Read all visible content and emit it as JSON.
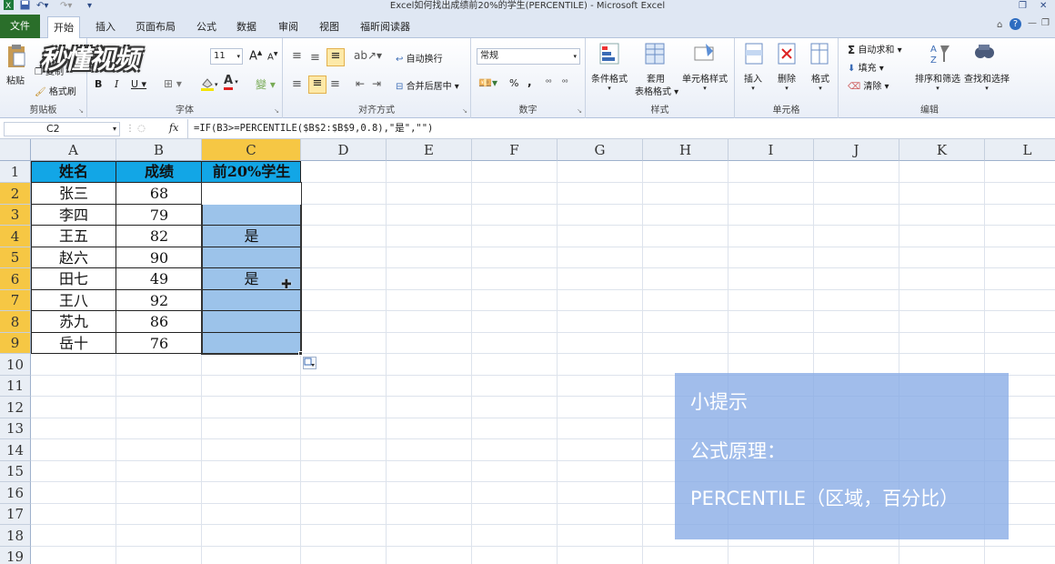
{
  "window": {
    "title": "Excel如何找出成绩前20%的学生(PERCENTILE)  -  Microsoft Excel"
  },
  "ribbon_tabs": [
    "文件",
    "开始",
    "插入",
    "页面布局",
    "公式",
    "数据",
    "审阅",
    "视图",
    "福昕阅读器"
  ],
  "ribbon": {
    "clipboard": {
      "paste": "粘贴",
      "copy": "复制",
      "format_painter": "格式刷",
      "label": "剪贴板"
    },
    "font": {
      "size": "11",
      "label": "字体",
      "bold": "B",
      "italic": "I",
      "underline": "U"
    },
    "alignment": {
      "wrap": "自动换行",
      "merge": "合并后居中",
      "label": "对齐方式"
    },
    "number": {
      "format": "常规",
      "percent": "%",
      "comma": ",",
      "label": "数字"
    },
    "styles": {
      "conditional": "条件格式",
      "table_fmt_1": "套用",
      "table_fmt_2": "表格格式",
      "cell_styles": "单元格样式",
      "label": "样式"
    },
    "cells": {
      "insert": "插入",
      "delete": "删除",
      "format": "格式",
      "label": "单元格"
    },
    "editing": {
      "autosum": "自动求和",
      "fill": "填充",
      "clear": "清除",
      "sort": "排序和筛选",
      "find": "查找和选择",
      "label": "编辑"
    }
  },
  "watermark_logo": "秒懂视频",
  "formula_bar": {
    "name_box": "C2",
    "fx": "fx",
    "formula": "=IF(B3>=PERCENTILE($B$2:$B$9,0.8),\"是\",\"\")"
  },
  "columns": [
    "A",
    "B",
    "C",
    "D",
    "E",
    "F",
    "G",
    "H",
    "I",
    "J",
    "K",
    "L"
  ],
  "rows": [
    "1",
    "2",
    "3",
    "4",
    "5",
    "6",
    "7",
    "8",
    "9",
    "10",
    "11",
    "12",
    "13",
    "14",
    "15",
    "16",
    "17",
    "18",
    "19"
  ],
  "table": {
    "headers": [
      "姓名",
      "成绩",
      "前20%学生"
    ],
    "data": [
      [
        "张三",
        "68",
        ""
      ],
      [
        "李四",
        "79",
        ""
      ],
      [
        "王五",
        "82",
        "是"
      ],
      [
        "赵六",
        "90",
        ""
      ],
      [
        "田七",
        "49",
        "是"
      ],
      [
        "王八",
        "92",
        ""
      ],
      [
        "苏九",
        "86",
        ""
      ],
      [
        "岳十",
        "76",
        ""
      ]
    ]
  },
  "tip": {
    "title": "小提示",
    "line1": "公式原理：",
    "line2": "PERCENTILE（区域，百分比）"
  },
  "colors": {
    "header_fill": "#12a6e6",
    "selection_fill": "#9cc3ea",
    "file_tab": "#2a6e2a",
    "active_header": "#f6c744"
  }
}
